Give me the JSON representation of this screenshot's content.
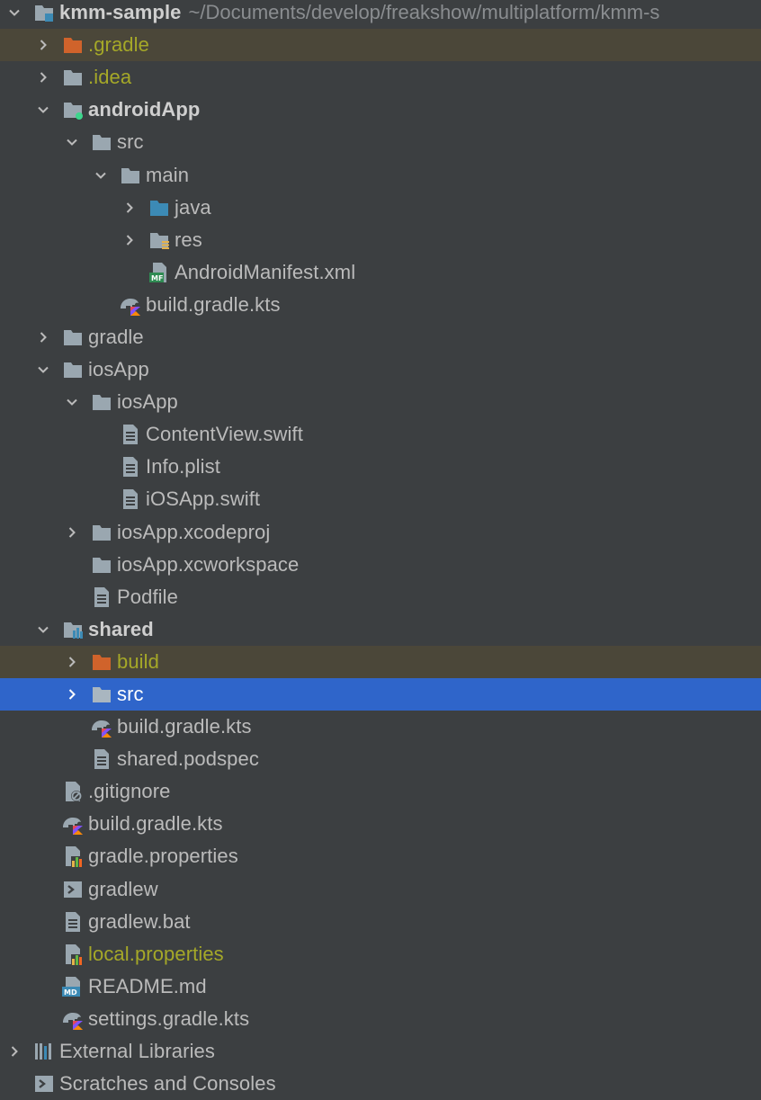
{
  "project_tree": {
    "root": {
      "label": "kmm-sample",
      "path": "~/Documents/develop/freakshow/multiplatform/kmm-s"
    },
    "items": [
      {
        "label": ".gradle",
        "icon": "excluded-folder-icon"
      },
      {
        "label": ".idea",
        "icon": "folder-icon"
      },
      {
        "label": "androidApp",
        "icon": "module-folder-icon"
      },
      {
        "label": "src",
        "icon": "folder-icon"
      },
      {
        "label": "main",
        "icon": "folder-icon"
      },
      {
        "label": "java",
        "icon": "source-folder-icon"
      },
      {
        "label": "res",
        "icon": "resource-folder-icon"
      },
      {
        "label": "AndroidManifest.xml",
        "icon": "manifest-file-icon"
      },
      {
        "label": "build.gradle.kts",
        "icon": "gradle-kotlin-file-icon"
      },
      {
        "label": "gradle",
        "icon": "folder-icon"
      },
      {
        "label": "iosApp",
        "icon": "folder-icon"
      },
      {
        "label": "iosApp",
        "icon": "folder-icon"
      },
      {
        "label": "ContentView.swift",
        "icon": "text-file-icon"
      },
      {
        "label": "Info.plist",
        "icon": "text-file-icon"
      },
      {
        "label": "iOSApp.swift",
        "icon": "text-file-icon"
      },
      {
        "label": "iosApp.xcodeproj",
        "icon": "folder-icon"
      },
      {
        "label": "iosApp.xcworkspace",
        "icon": "folder-icon"
      },
      {
        "label": "Podfile",
        "icon": "text-file-icon"
      },
      {
        "label": "shared",
        "icon": "module-folder-icon"
      },
      {
        "label": "build",
        "icon": "excluded-folder-icon"
      },
      {
        "label": "src",
        "icon": "folder-icon"
      },
      {
        "label": "build.gradle.kts",
        "icon": "gradle-kotlin-file-icon"
      },
      {
        "label": "shared.podspec",
        "icon": "text-file-icon"
      },
      {
        "label": ".gitignore",
        "icon": "ignore-file-icon"
      },
      {
        "label": "build.gradle.kts",
        "icon": "gradle-kotlin-file-icon"
      },
      {
        "label": "gradle.properties",
        "icon": "properties-file-icon"
      },
      {
        "label": "gradlew",
        "icon": "shell-script-icon"
      },
      {
        "label": "gradlew.bat",
        "icon": "text-file-icon"
      },
      {
        "label": "local.properties",
        "icon": "properties-file-icon"
      },
      {
        "label": "README.md",
        "icon": "markdown-file-icon"
      },
      {
        "label": "settings.gradle.kts",
        "icon": "gradle-kotlin-file-icon"
      },
      {
        "label": "External Libraries",
        "icon": "libraries-icon"
      },
      {
        "label": "Scratches and Consoles",
        "icon": "scratches-icon"
      }
    ]
  },
  "colors": {
    "background": "#3c3f41",
    "selection": "#2f65ca",
    "ignored_row": "#4b4739",
    "ignored_text": "#a5a828",
    "text": "#bbbbbb",
    "folder": "#9aa7b0",
    "source_folder": "#3c8ab5",
    "excluded_folder": "#d0632b"
  }
}
